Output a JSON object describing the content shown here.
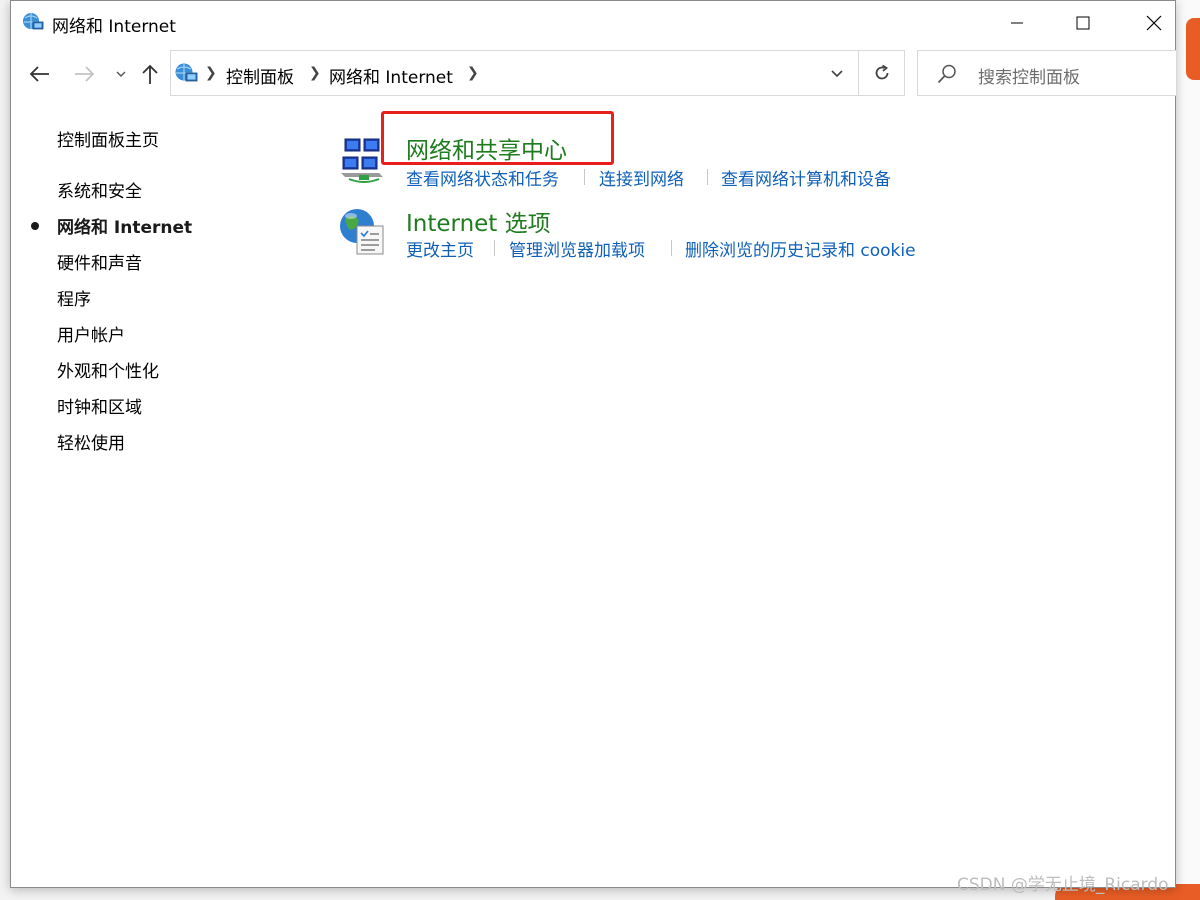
{
  "window": {
    "title": "网络和 Internet"
  },
  "nav": {
    "back_label": "←",
    "forward_label": "→",
    "recent_label": "⌄",
    "up_label": "↑"
  },
  "address_bar": {
    "crumbs": [
      "控制面板",
      "网络和 Internet"
    ]
  },
  "search": {
    "placeholder": "搜索控制面板"
  },
  "sidebar": {
    "home": "控制面板主页",
    "items": [
      {
        "label": "系统和安全",
        "active": false
      },
      {
        "label": "网络和 Internet",
        "active": true
      },
      {
        "label": "硬件和声音",
        "active": false
      },
      {
        "label": "程序",
        "active": false
      },
      {
        "label": "用户帐户",
        "active": false
      },
      {
        "label": "外观和个性化",
        "active": false
      },
      {
        "label": "时钟和区域",
        "active": false
      },
      {
        "label": "轻松使用",
        "active": false
      }
    ]
  },
  "categories": [
    {
      "title": "网络和共享中心",
      "links": [
        "查看网络状态和任务",
        "连接到网络",
        "查看网络计算机和设备"
      ]
    },
    {
      "title": "Internet 选项",
      "links": [
        "更改主页",
        "管理浏览器加载项",
        "删除浏览的历史记录和 cookie"
      ]
    }
  ],
  "watermark": "CSDN @学无止境_Ricardo",
  "colors": {
    "category_title": "#1e7b1e",
    "task_link": "#0f60b8",
    "highlight_box": "#e8201c"
  }
}
